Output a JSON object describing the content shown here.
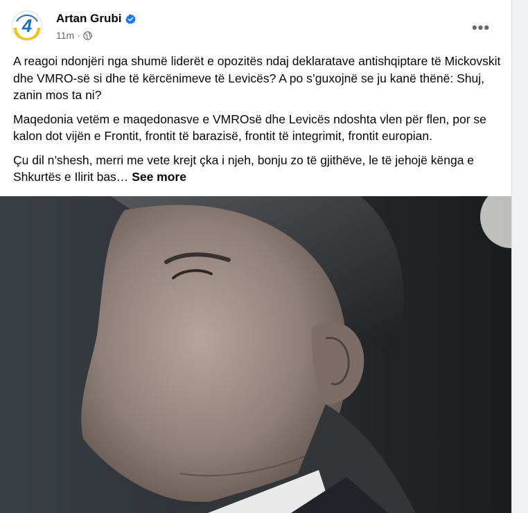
{
  "post": {
    "author_name": "Artan Grubi",
    "verified_icon": "verified-badge-icon",
    "time_ago": "11m",
    "separator": "·",
    "audience_icon": "globe-icon",
    "more_label": "•••",
    "avatar": {
      "text": "4",
      "colors": [
        "#1c6fb8",
        "#f2c400"
      ]
    },
    "paragraphs": [
      "A reagoi ndonjëri nga shumë liderët e opozitës ndaj deklaratave antishqiptare të Mickovskit dhe VMRO-së si dhe të kërcënimeve të Levicës? A po s’guxojnë se ju kanë thënë: Shuj, zanin mos ta ni?",
      "Maqedonia vetëm e maqedonasve e VMROsë dhe Levicës ndoshta vlen për flen, por se kalon dot vijën e Frontit, frontit të barazisë, frontit të integrimit, frontit europian.",
      "Çu dil n’shesh, merri me vete krejt çka i njeh, bonju zo të gjithëve, le të jehojë kënga e Shkurtës e Ilirit bas…"
    ],
    "see_more": "See more"
  },
  "colors": {
    "text_primary": "#050505",
    "text_secondary": "#65676b",
    "verified_blue": "#1877f2"
  }
}
